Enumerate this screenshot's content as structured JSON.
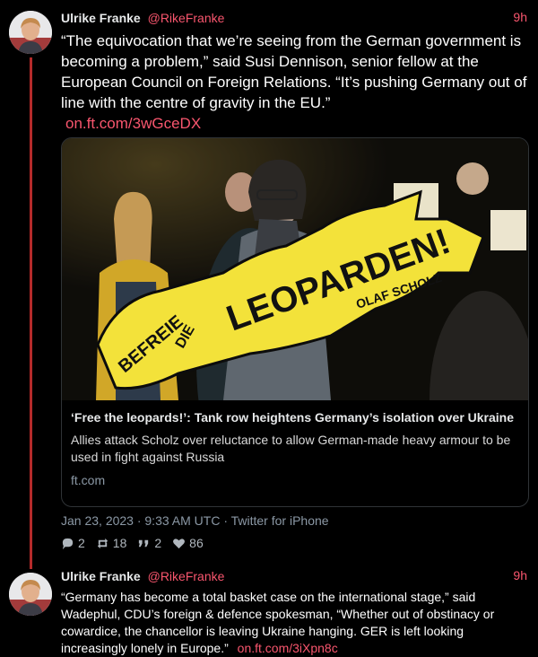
{
  "tweets": [
    {
      "name": "Ulrike Franke",
      "handle": "@RikeFranke",
      "time": "9h",
      "text": "“The equivocation that we’re seeing from the German government is becoming a problem,” said Susi Dennison, senior fellow at the European Council on Foreign Relations. “It’s pushing Germany out of line with the centre of gravity in the EU.”",
      "link": "on.ft.com/3wGceDX",
      "card": {
        "sign_text": "BEFREIE DIE LEOPARDEN!",
        "sign_signature": "OLAF SCHOLZ",
        "title": "‘Free the leopards!’: Tank row heightens Germany’s isolation over Ukraine",
        "description": "Allies attack Scholz over reluctance to allow German-made heavy armour to be used in fight against Russia",
        "domain": "ft.com"
      },
      "meta": "Jan 23, 2023 · 9:33 AM UTC · Twitter for iPhone",
      "stats": {
        "replies": "2",
        "retweets": "18",
        "quotes": "2",
        "likes": "86"
      }
    },
    {
      "name": "Ulrike Franke",
      "handle": "@RikeFranke",
      "time": "9h",
      "text": "“Germany has become a total basket case on the international stage,” said Wadephul, CDU’s foreign & defence spokesman, “Whether out of obstinacy or cowardice, the chancellor is leaving Ukraine hanging. GER is left looking increasingly lonely in Europe.”",
      "link": "on.ft.com/3iXpn8c"
    }
  ],
  "colors": {
    "accent": "#f9566e",
    "thread_line": "#b42a2a",
    "background": "#000000",
    "sign_yellow": "#f3e23a"
  },
  "icons": [
    "reply-icon",
    "retweet-icon",
    "quote-icon",
    "heart-icon"
  ]
}
